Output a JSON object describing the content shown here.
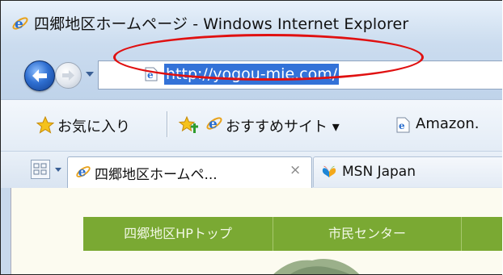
{
  "window": {
    "title": "四郷地区ホームページ - Windows Internet Explorer"
  },
  "navigation": {
    "url": "http://yogou-mie.com/",
    "back_icon": "back-arrow-icon",
    "forward_icon": "forward-arrow-icon"
  },
  "favorites": {
    "label": "お気に入り",
    "suggested_sites_label": "おすすめサイト ▾",
    "amazon_label": "Amazon."
  },
  "tabs": [
    {
      "label": "四郷地区ホームペ...",
      "close": "×",
      "active": true
    },
    {
      "label": "MSN Japan",
      "active": false
    }
  ],
  "page": {
    "nav": [
      "四郷地区HPトップ",
      "市民センター"
    ]
  },
  "colors": {
    "ie_blue": "#2f6fd1",
    "url_highlight": "#3372d8",
    "annotation_red": "#e01010",
    "nav_green": "#7aa933"
  }
}
